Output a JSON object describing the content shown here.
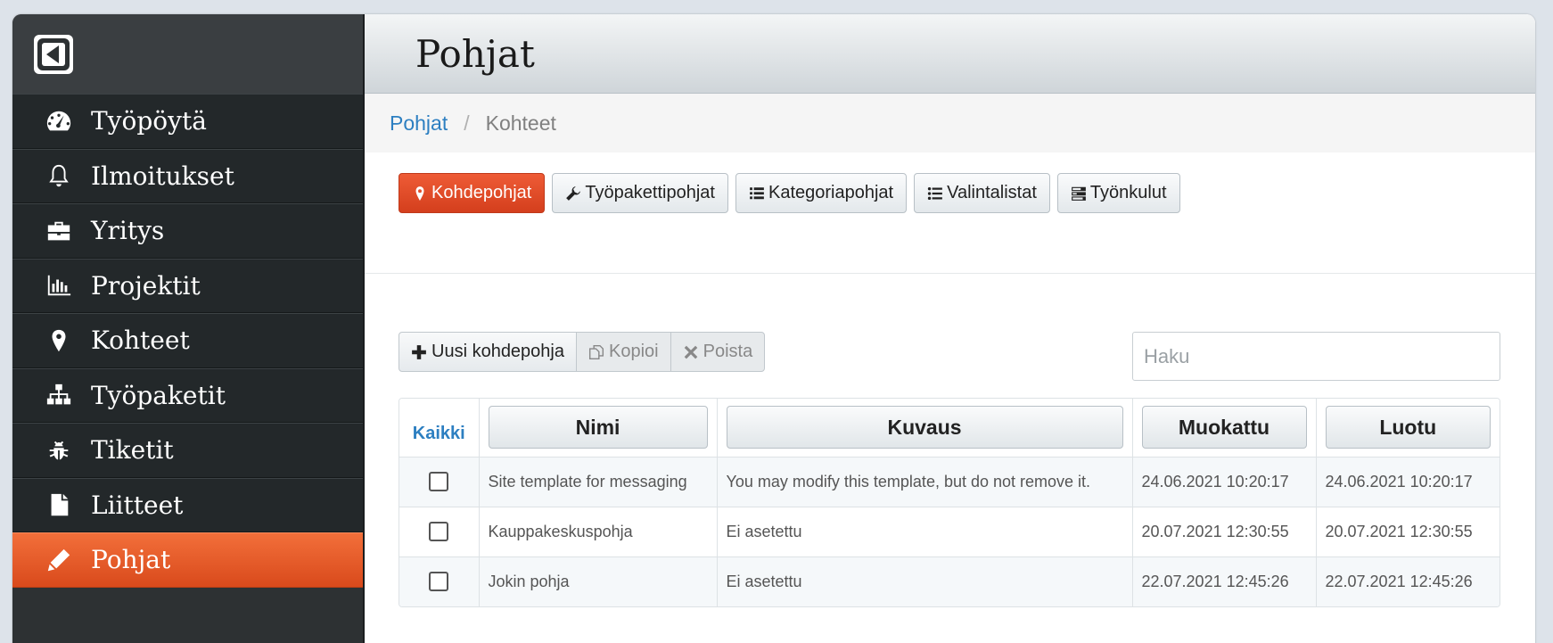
{
  "sidebar": {
    "items": [
      {
        "label": "Työpöytä",
        "icon": "dashboard-icon"
      },
      {
        "label": "Ilmoitukset",
        "icon": "bell-icon"
      },
      {
        "label": "Yritys",
        "icon": "briefcase-icon"
      },
      {
        "label": "Projektit",
        "icon": "bar-chart-icon"
      },
      {
        "label": "Kohteet",
        "icon": "map-marker-icon"
      },
      {
        "label": "Työpaketit",
        "icon": "sitemap-icon"
      },
      {
        "label": "Tiketit",
        "icon": "bug-icon"
      },
      {
        "label": "Liitteet",
        "icon": "file-icon"
      },
      {
        "label": "Pohjat",
        "icon": "pencil-icon",
        "active": true
      }
    ]
  },
  "header": {
    "title": "Pohjat"
  },
  "breadcrumb": {
    "link": "Pohjat",
    "separator": "/",
    "current": "Kohteet"
  },
  "tabs": [
    {
      "label": "Kohdepohjat",
      "icon": "map-marker-icon",
      "active": true
    },
    {
      "label": "Työpakettipohjat",
      "icon": "wrench-icon"
    },
    {
      "label": "Kategoriapohjat",
      "icon": "list-icon"
    },
    {
      "label": "Valintalistat",
      "icon": "list-ul-icon"
    },
    {
      "label": "Työnkulut",
      "icon": "tasks-icon"
    }
  ],
  "toolbar": {
    "new_label": "Uusi kohdepohja",
    "copy_label": "Kopioi",
    "delete_label": "Poista"
  },
  "search": {
    "placeholder": "Haku"
  },
  "table": {
    "select_all": "Kaikki",
    "columns": [
      "Nimi",
      "Kuvaus",
      "Muokattu",
      "Luotu"
    ],
    "rows": [
      {
        "name": "Site template for messaging",
        "description": "You may modify this template, but do not remove it.",
        "modified": "24.06.2021 10:20:17",
        "created": "24.06.2021 10:20:17"
      },
      {
        "name": "Kauppakeskuspohja",
        "description": "Ei asetettu",
        "modified": "20.07.2021 12:30:55",
        "created": "20.07.2021 12:30:55"
      },
      {
        "name": "Jokin pohja",
        "description": "Ei asetettu",
        "modified": "22.07.2021 12:45:26",
        "created": "22.07.2021 12:45:26"
      }
    ]
  },
  "colors": {
    "accent": "#e5522b",
    "link": "#2d7fc1",
    "sidebar": "#23282a"
  }
}
